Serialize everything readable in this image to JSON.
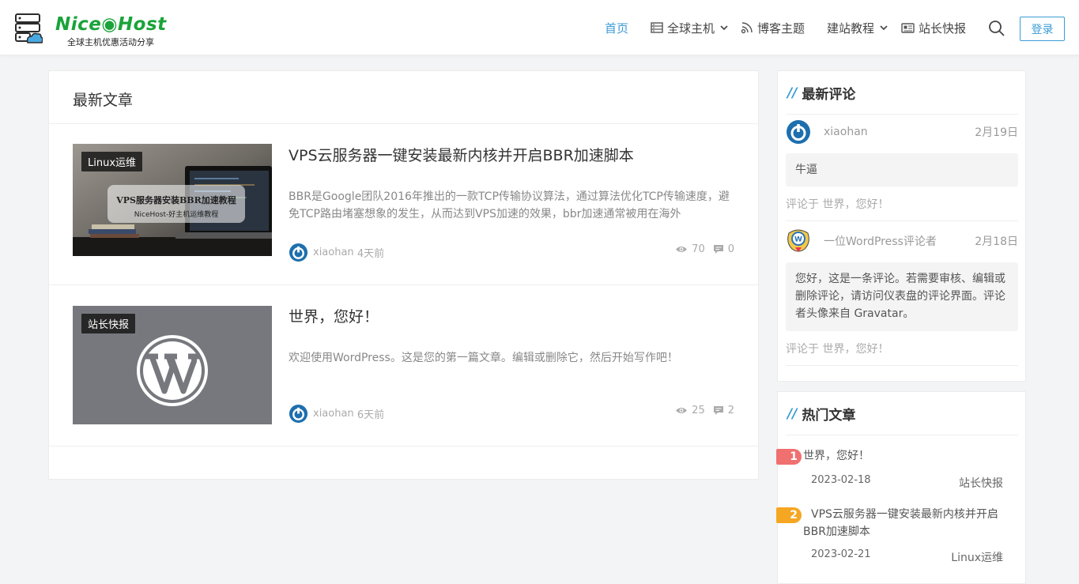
{
  "header": {
    "logo_text": "Nice◉Host",
    "logo_sub": "全球主机优惠活动分享",
    "nav": [
      {
        "label": "首页",
        "active": true
      },
      {
        "label": "全球主机",
        "icon": "server-icon",
        "dropdown": true
      },
      {
        "label": "博客主题",
        "icon": "rss-icon"
      },
      {
        "label": "建站教程",
        "dropdown": true
      },
      {
        "label": "站长快报",
        "icon": "newspaper-icon"
      }
    ],
    "login_label": "登录"
  },
  "main": {
    "title": "最新文章",
    "posts": [
      {
        "tag": "Linux运维",
        "thumb_title": "VPS服务器安装BBR加速教程",
        "thumb_sub": "NiceHost-好主机运维教程",
        "title": "VPS云服务器一键安装最新内核并开启BBR加速脚本",
        "excerpt": "BBR是Google团队2016年推出的一款TCP传输协议算法，通过算法优化TCP传输速度，避免TCP路由堵塞想象的发生，从而达到VPS加速的效果，bbr加速通常被用在海外",
        "author": "xiaohan",
        "time": "4天前",
        "views": "70",
        "comments": "0"
      },
      {
        "tag": "站长快报",
        "title": "世界，您好！",
        "excerpt": "欢迎使用WordPress。这是您的第一篇文章。编辑或删除它，然后开始写作吧！",
        "author": "xiaohan",
        "time": "6天前",
        "views": "25",
        "comments": "2"
      }
    ]
  },
  "recent_comments": {
    "title": "最新评论",
    "items": [
      {
        "name": "xiaohan",
        "date": "2月19日",
        "text": "牛逼",
        "on_prefix": "评论于",
        "on_post": "世界，您好！"
      },
      {
        "name": "一位WordPress评论者",
        "date": "2月18日",
        "text": "您好，这是一条评论。若需要审核、编辑或删除评论，请访问仪表盘的评论界面。评论者头像来自 Gravatar。",
        "on_prefix": "评论于",
        "on_post": "世界，您好！"
      }
    ]
  },
  "hot_posts": {
    "title": "热门文章",
    "items": [
      {
        "rank": "1",
        "title": "世界，您好！",
        "date": "2023-02-18",
        "category": "站长快报",
        "color": "#f07070"
      },
      {
        "rank": "2",
        "title": "VPS云服务器一键安装最新内核并开启BBR加速脚本",
        "date": "2023-02-21",
        "category": "Linux运维",
        "color": "#f5a623"
      }
    ]
  },
  "colors": {
    "accent": "#3a9bd5",
    "brand": "#1aa33a"
  }
}
